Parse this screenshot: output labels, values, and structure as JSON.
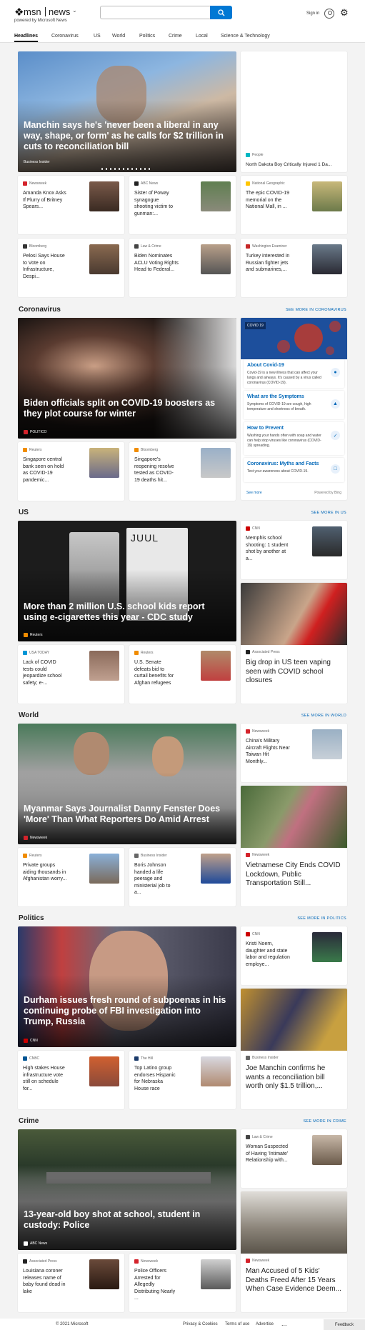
{
  "header": {
    "logo_msn": "msn",
    "logo_news": "news",
    "powered": "powered by Microsoft News",
    "search_placeholder": "",
    "signin": "Sign in"
  },
  "nav": [
    "Headlines",
    "Coronavirus",
    "US",
    "World",
    "Politics",
    "Crime",
    "Local",
    "Science & Technology"
  ],
  "headlines": {
    "hero": {
      "title": "Manchin says he's 'never been a liberal in any way, shape, or form' as he calls for $2 trillion in cuts to reconciliation bill",
      "source": "Business Insider"
    },
    "side": {
      "source": "People",
      "title": "North Dakota Boy Critically Injured 1 Da..."
    },
    "cards": [
      {
        "source": "Newsweek",
        "title": "Amanda Knox Asks If Flurry of Britney Spears..."
      },
      {
        "source": "ABC News",
        "title": "Sister of Poway synagogue shooting victim to gunman:..."
      },
      {
        "source": "National Geographic",
        "title": "The epic COVID-19 memorial on the National Mall, in ..."
      },
      {
        "source": "Bloomberg",
        "title": "Pelosi Says House to Vote on Infrastructure, Despi..."
      },
      {
        "source": "Law & Crime",
        "title": "Biden Nominates ACLU Voting Rights Head to Federal..."
      },
      {
        "source": "Washington Examiner",
        "title": "Turkey interested in Russian fighter jets and submarines,..."
      }
    ]
  },
  "coronavirus": {
    "title": "Coronavirus",
    "more": "SEE MORE IN CORONAVIRUS",
    "hero": {
      "title": "Biden officials split on COVID-19 boosters as they plot course for winter",
      "source": "POLITICO"
    },
    "cards": [
      {
        "source": "Reuters",
        "title": "Singapore central bank seen on hold as COVID-19 pandemic..."
      },
      {
        "source": "Bloomberg",
        "title": "Singapore's reopening resolve tested as COVID-19 deaths hit..."
      }
    ],
    "panel": {
      "badge": "COVID 19",
      "items": [
        {
          "h": "About Covid-19",
          "d": "Covid-19 is a new illness that can affect your lungs and airways. It's caused by a virus called coronavirus (COVID-19)."
        },
        {
          "h": "What are the Symptoms",
          "d": "Symptoms of COVID-19 are cough, high temperature and shortness of breath."
        },
        {
          "h": "How to Prevent",
          "d": "Washing your hands often with soap and water can help stop viruses like coronavirus (COVID-19) spreading."
        },
        {
          "h": "Coronavirus: Myths and Facts",
          "d": "Test your awareness about COVID-19."
        }
      ],
      "see_more": "See more",
      "powered": "Powered by Bing"
    }
  },
  "us": {
    "title": "US",
    "more": "SEE MORE IN US",
    "hero": {
      "title": "More than 2 million U.S. school kids report using e-cigarettes this year - CDC study",
      "source": "Reuters"
    },
    "side": {
      "source": "CNN",
      "title": "Memphis school shooting: 1 student shot by another at a..."
    },
    "cards": [
      {
        "source": "USA TODAY",
        "title": "Lack of COVID tests could jeopardize school safety; e-..."
      },
      {
        "source": "Reuters",
        "title": "U.S. Senate defeats bid to curtail benefits for Afghan refugees"
      }
    ],
    "big": {
      "source": "Associated Press",
      "title": "Big drop in US teen vaping seen with COVID school closures"
    },
    "juul": "JUUL"
  },
  "world": {
    "title": "World",
    "more": "SEE MORE IN WORLD",
    "hero": {
      "title": "Myanmar Says Journalist Danny Fenster Does 'More' Than What Reporters Do Amid Arrest",
      "source": "Newsweek"
    },
    "side": {
      "source": "Newsweek",
      "title": "China's Military Aircraft Flights Near Taiwan Hit Monthly..."
    },
    "cards": [
      {
        "source": "Reuters",
        "title": "Private groups aiding thousands in Afghanistan worry..."
      },
      {
        "source": "Business Insider",
        "title": "Boris Johnson handed a life peerage and ministerial job to a..."
      }
    ],
    "big": {
      "source": "Newsweek",
      "title": "Vietnamese City Ends COVID Lockdown, Public Transportation Still..."
    }
  },
  "politics": {
    "title": "Politics",
    "more": "SEE MORE IN POLITICS",
    "hero": {
      "title": "Durham issues fresh round of subpoenas in his continuing probe of FBI investigation into Trump, Russia",
      "source": "CNN"
    },
    "side": {
      "source": "CNN",
      "title": "Kristi Noem, daughter and state labor and regulation employe..."
    },
    "cards": [
      {
        "source": "CNBC",
        "title": "High stakes House infrastructure vote still on schedule for..."
      },
      {
        "source": "The Hill",
        "title": "Top Latino group endorses Hispanic for Nebraska House race"
      }
    ],
    "big": {
      "source": "Business Insider",
      "title": "Joe Manchin confirms he wants a reconciliation bill worth only $1.5 trillion,..."
    }
  },
  "crime": {
    "title": "Crime",
    "more": "SEE MORE IN CRIME",
    "hero": {
      "title": "13-year-old boy shot at school, student in custody: Police",
      "source": "ABC News"
    },
    "side": {
      "source": "Law & Crime",
      "title": "Woman Suspected of Having 'Intimate' Relationship with..."
    },
    "cards": [
      {
        "source": "Associated Press",
        "title": "Louisiana coroner releases name of baby found dead in lake"
      },
      {
        "source": "Newsweek",
        "title": "Police Officers Arrested for Allegedly Distributing Nearly ..."
      }
    ],
    "big": {
      "source": "Newsweek",
      "title": "Man Accused of 5 Kids' Deaths Freed After 15 Years When Case Evidence Deem..."
    }
  },
  "footer": {
    "copyright": "© 2021 Microsoft",
    "privacy": "Privacy & Cookies",
    "terms": "Terms of use",
    "advertise": "Advertise",
    "more": "...",
    "feedback": "Feedback"
  },
  "colors": {
    "accent": "#0067b8",
    "search": "#0078d4",
    "newsweek": "#d4232b"
  }
}
